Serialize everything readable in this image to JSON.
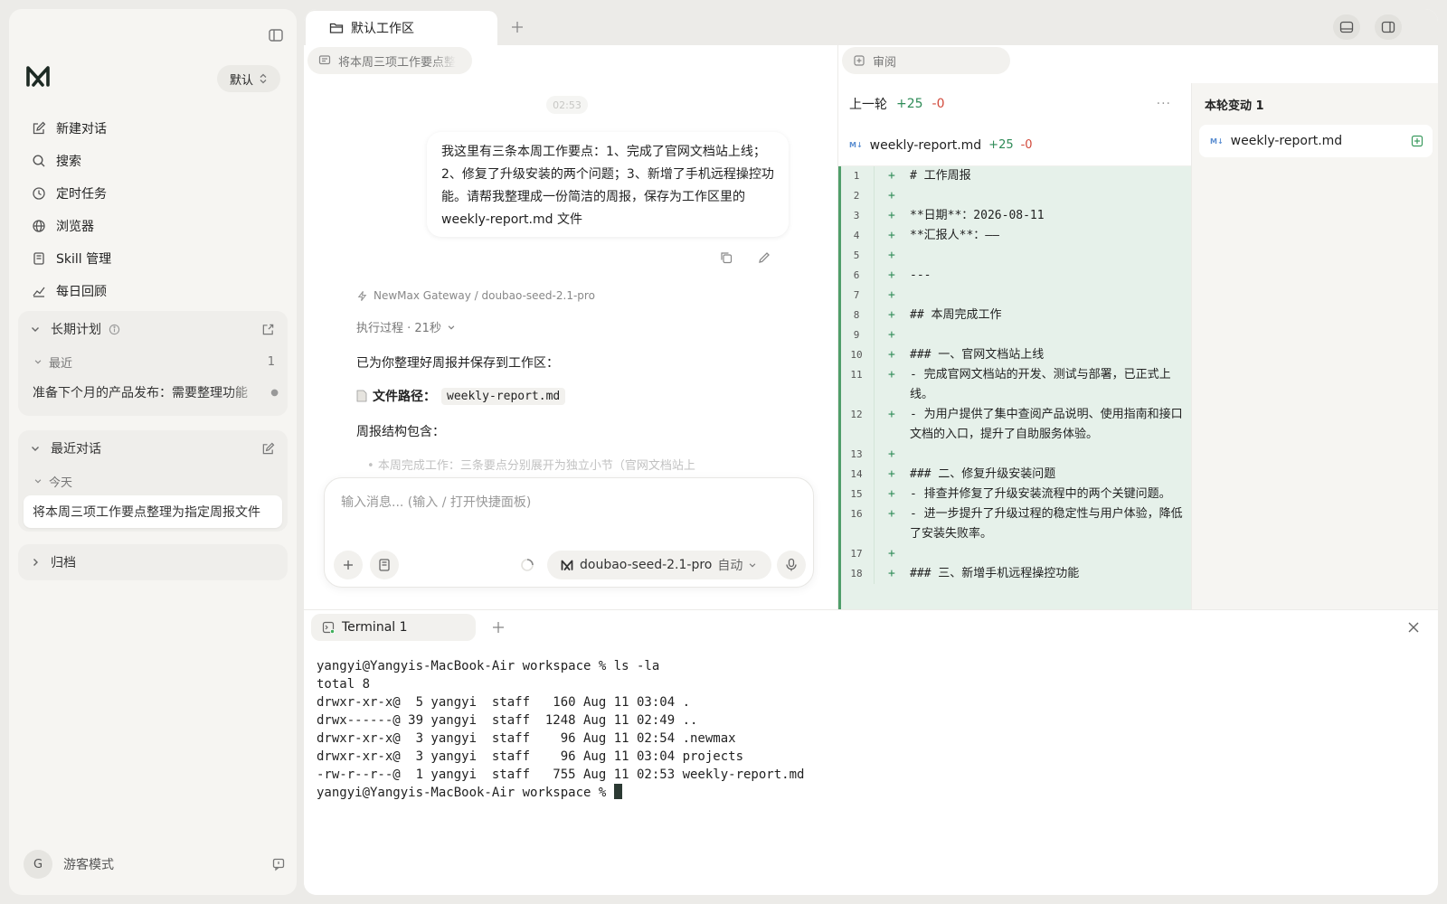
{
  "sidebar": {
    "profile": "默认",
    "nav": [
      "新建对话",
      "搜索",
      "定时任务",
      "浏览器",
      "Skill 管理",
      "每日回顾"
    ],
    "long_term": {
      "title": "长期计划",
      "recent_label": "最近",
      "recent_count": "1",
      "item": "准备下个月的产品发布：需要整理功能"
    },
    "recent_chats": {
      "title": "最近对话",
      "today_label": "今天",
      "item": "将本周三项工作要点整理为指定周报文件"
    },
    "archive": "归档",
    "user": {
      "avatar": "G",
      "name": "游客模式"
    }
  },
  "main": {
    "workspace_tab": "默认工作区",
    "chat": {
      "title_chip": "将本周三项工作要点整",
      "time": "02:53",
      "user_message": "我这里有三条本周工作要点：1、完成了官网文档站上线；2、修复了升级安装的两个问题；3、新增了手机远程操控功能。请帮我整理成一份简洁的周报，保存为工作区里的 weekly-report.md 文件",
      "model_line": "NewMax Gateway / doubao-seed-2.1-pro",
      "exec_line": "执行过程 · 21秒",
      "reply_intro": "已为你整理好周报并保存到工作区：",
      "file_path_label": "文件路径：",
      "file_path": "weekly-report.md",
      "structure_label": "周报结构包含：",
      "faded_line": "本周完成工作：三条要点分别展开为独立小节（官网文档站上",
      "input_placeholder": "输入消息... (输入 / 打开快捷面板)",
      "model_selector": "doubao-seed-2.1-pro",
      "model_mode": "自动"
    },
    "review": {
      "chip": "审阅",
      "prev_turn": "上一轮",
      "adds": "+25",
      "dels": "-0",
      "file": "weekly-report.md",
      "file_adds": "+25",
      "file_dels": "-0",
      "diff_lines": [
        {
          "n": "1",
          "t": "# 工作周报"
        },
        {
          "n": "2",
          "t": ""
        },
        {
          "n": "3",
          "t": "**日期**：2026-08-11"
        },
        {
          "n": "4",
          "t": "**汇报人**：——"
        },
        {
          "n": "5",
          "t": ""
        },
        {
          "n": "6",
          "t": "---"
        },
        {
          "n": "7",
          "t": ""
        },
        {
          "n": "8",
          "t": "## 本周完成工作"
        },
        {
          "n": "9",
          "t": ""
        },
        {
          "n": "10",
          "t": "### 一、官网文档站上线"
        },
        {
          "n": "11",
          "t": "- 完成官网文档站的开发、测试与部署，已正式上线。"
        },
        {
          "n": "12",
          "t": "- 为用户提供了集中查阅产品说明、使用指南和接口文档的入口，提升了自助服务体验。"
        },
        {
          "n": "13",
          "t": ""
        },
        {
          "n": "14",
          "t": "### 二、修复升级安装问题"
        },
        {
          "n": "15",
          "t": "- 排查并修复了升级安装流程中的两个关键问题。"
        },
        {
          "n": "16",
          "t": "- 进一步提升了升级过程的稳定性与用户体验，降低了安装失败率。"
        },
        {
          "n": "17",
          "t": ""
        },
        {
          "n": "18",
          "t": "### 三、新增手机远程操控功能"
        }
      ],
      "turn_changes_title": "本轮变动 1",
      "turn_file": "weekly-report.md"
    },
    "terminal": {
      "tab": "Terminal 1",
      "lines": [
        "yangyi@Yangyis-MacBook-Air workspace % ls -la",
        "total 8",
        "drwxr-xr-x@  5 yangyi  staff   160 Aug 11 03:04 .",
        "drwx------@ 39 yangyi  staff  1248 Aug 11 02:49 ..",
        "drwxr-xr-x@  3 yangyi  staff    96 Aug 11 02:54 .newmax",
        "drwxr-xr-x@  3 yangyi  staff    96 Aug 11 03:04 projects",
        "-rw-r--r--@  1 yangyi  staff   755 Aug 11 02:53 weekly-report.md"
      ],
      "prompt": "yangyi@Yangyis-MacBook-Air workspace % "
    }
  }
}
